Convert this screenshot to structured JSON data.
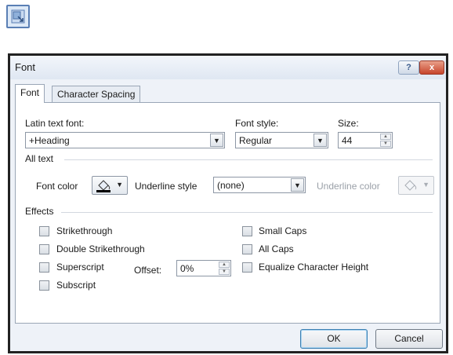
{
  "launcher": {
    "icon": "dialog-launcher-icon"
  },
  "dialog": {
    "title": "Font",
    "help_label": "?",
    "close_label": "x"
  },
  "tabs": [
    {
      "label": "Font",
      "active": true
    },
    {
      "label": "Character Spacing",
      "active": false
    }
  ],
  "fields": {
    "latin_font_label": "Latin text font:",
    "latin_font_value": "+Heading",
    "font_style_label": "Font style:",
    "font_style_value": "Regular",
    "size_label": "Size:",
    "size_value": "44"
  },
  "all_text": {
    "heading": "All text",
    "font_color_label": "Font color",
    "underline_style_label": "Underline style",
    "underline_style_value": "(none)",
    "underline_color_label": "Underline color",
    "font_color_accent": "#000000"
  },
  "effects": {
    "heading": "Effects",
    "strikethrough": "Strikethrough",
    "double_strikethrough": "Double Strikethrough",
    "superscript": "Superscript",
    "subscript": "Subscript",
    "offset_label": "Offset:",
    "offset_value": "0%",
    "small_caps": "Small Caps",
    "all_caps": "All Caps",
    "equalize": "Equalize Character Height"
  },
  "buttons": {
    "ok": "OK",
    "cancel": "Cancel"
  }
}
